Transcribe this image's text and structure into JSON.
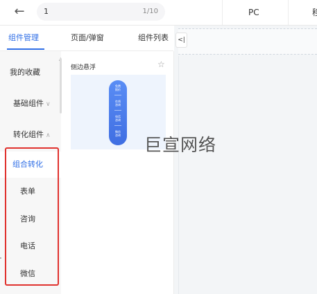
{
  "header": {
    "page_current": "1",
    "page_total": "1/10",
    "platforms": [
      "PC",
      "移"
    ]
  },
  "panel_tabs": [
    "组件管理",
    "页面/弹窗",
    "组件列表"
  ],
  "categories": {
    "favorites": "我的收藏",
    "basic": "基础组件",
    "conversion": "转化组件",
    "conversion_items": [
      "组合转化",
      "表单",
      "咨询",
      "电话",
      "微信"
    ]
  },
  "component": {
    "title": "侧边悬浮",
    "pill_labels": [
      "免费\n报价",
      "在线\n咨询",
      "电话\n咨询",
      "微信\n咨询"
    ]
  },
  "collapse_label": "<|",
  "watermark": "巨宣网络",
  "colors": {
    "accent": "#2f6ee6",
    "highlight": "#e0312d",
    "pill": "#4a7cec"
  },
  "icons": {
    "back": "arrow-left-icon",
    "star": "star-outline-icon",
    "chevron": "chevron-down-icon"
  }
}
